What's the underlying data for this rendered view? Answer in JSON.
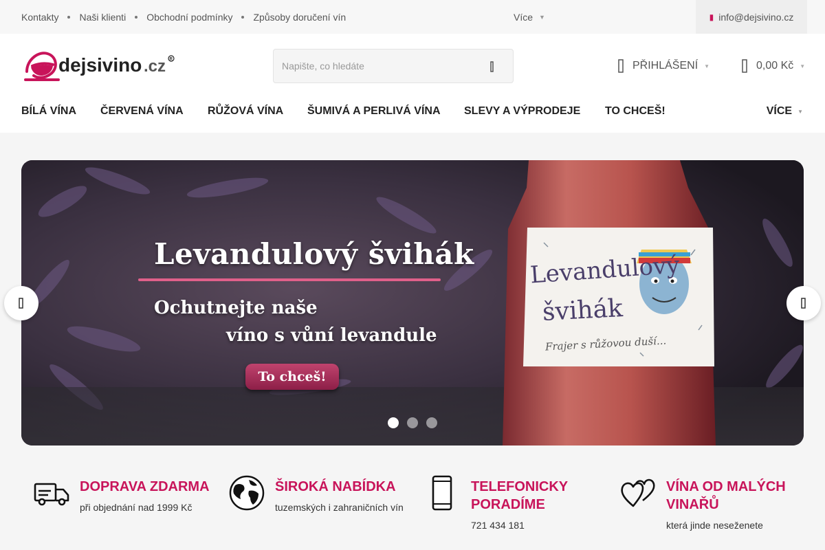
{
  "topbar": {
    "links": [
      "Kontakty",
      "Naši klienti",
      "Obchodní podmínky",
      "Způsoby doručení vín"
    ],
    "more_label": "Více",
    "email": "info@dejsivino.cz"
  },
  "header": {
    "logo_text": "dejsivino",
    "logo_tld": ".cz",
    "search_placeholder": "Napište, co hledáte",
    "login_label": "PŘIHLÁŠENÍ",
    "cart_total": "0,00 Kč"
  },
  "nav": {
    "items": [
      "BÍLÁ VÍNA",
      "ČERVENÁ VÍNA",
      "RŮŽOVÁ VÍNA",
      "ŠUMIVÁ A PERLIVÁ VÍNA",
      "SLEVY A VÝPRODEJE",
      "TO CHCEŠ!"
    ],
    "more_label": "VÍCE"
  },
  "banner": {
    "title": "Levandulový švihák",
    "subtitle_line1": "Ochutnejte naše",
    "subtitle_line2": "víno s vůní levandule",
    "cta": "To chceš!",
    "label_line1": "Levandulový",
    "label_line2": "švihák",
    "label_tagline": "Frajer s růžovou duší...",
    "slide_count": 3,
    "active_slide": 1
  },
  "features": [
    {
      "icon": "truck-icon",
      "title": "DOPRAVA ZDARMA",
      "text": "při objednání nad 1999 Kč"
    },
    {
      "icon": "globe-icon",
      "title": "ŠIROKÁ NABÍDKA",
      "text": "tuzemských i zahraničních vín"
    },
    {
      "icon": "phone-icon",
      "title": "TELEFONICKY PORADÍME",
      "text": "721 434 181"
    },
    {
      "icon": "hearts-icon",
      "title": "VÍNA OD MALÝCH VINAŘŮ",
      "text": "která jinde neseženete"
    }
  ],
  "colors": {
    "accent": "#c8145a",
    "topbar_bg": "#f7f7f7",
    "section_bg": "#f5f5f5"
  }
}
